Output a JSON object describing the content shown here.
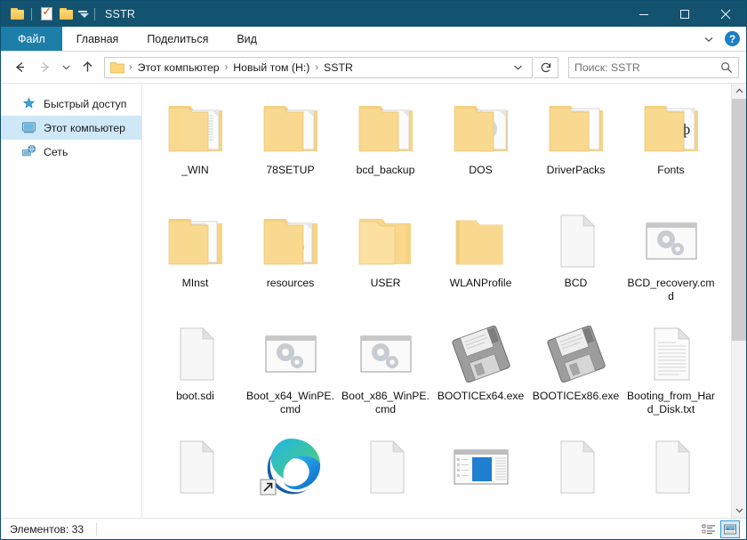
{
  "window": {
    "title": "SSTR",
    "quick_access": [
      "folder-icon",
      "properties-icon",
      "new-folder-icon",
      "customize-caret-icon"
    ],
    "controls": {
      "minimize": "Свернуть",
      "maximize": "Развернуть",
      "close": "Закрыть"
    },
    "titlebar_color": "#13536f",
    "accent_color": "#1d7eaa"
  },
  "ribbon": {
    "tabs": [
      {
        "label": "Файл",
        "active": true
      },
      {
        "label": "Главная",
        "active": false
      },
      {
        "label": "Поделиться",
        "active": false
      },
      {
        "label": "Вид",
        "active": false
      }
    ],
    "expand_icon": "chevron-down-icon",
    "help_label": "?"
  },
  "nav": {
    "back": "Назад",
    "forward": "Вперёд",
    "recent": "Последние папки",
    "up": "Вверх",
    "refresh_icon": "refresh-icon",
    "breadcrumb": [
      "Этот компьютер",
      "Новый том (H:)",
      "SSTR"
    ],
    "breadcrumb_sep": "›"
  },
  "search": {
    "placeholder": "Поиск: SSTR",
    "icon": "search-icon"
  },
  "sidebar": {
    "items": [
      {
        "label": "Быстрый доступ",
        "icon": "pin-star-icon",
        "selected": false
      },
      {
        "label": "Этот компьютер",
        "icon": "computer-icon",
        "selected": true
      },
      {
        "label": "Сеть",
        "icon": "network-icon",
        "selected": false
      }
    ]
  },
  "files": [
    {
      "name": "_WIN",
      "type": "folder",
      "preview": "text-doc"
    },
    {
      "name": "78SETUP",
      "type": "folder",
      "preview": "setup-exe"
    },
    {
      "name": "bcd_backup",
      "type": "folder",
      "preview": "blank-doc"
    },
    {
      "name": "DOS",
      "type": "folder",
      "preview": "disc"
    },
    {
      "name": "DriverPacks",
      "type": "folder",
      "preview": "lined-doc"
    },
    {
      "name": "Fonts",
      "type": "folder",
      "preview": "font-abf",
      "preview_text": "Абф"
    },
    {
      "name": "MInst",
      "type": "folder",
      "preview": "blank-doc"
    },
    {
      "name": "resources",
      "type": "folder",
      "preview": "gears-doc"
    },
    {
      "name": "USER",
      "type": "folder",
      "preview": "photo-doc"
    },
    {
      "name": "WLANProfile",
      "type": "folder",
      "preview": "empty"
    },
    {
      "name": "BCD",
      "type": "file",
      "preview": "blank-file"
    },
    {
      "name": "BCD_recovery.cmd",
      "type": "file",
      "preview": "cmd-gears"
    },
    {
      "name": "boot.sdi",
      "type": "file",
      "preview": "blank-file"
    },
    {
      "name": "Boot_x64_WinPE.cmd",
      "type": "file",
      "preview": "cmd-gears"
    },
    {
      "name": "Boot_x86_WinPE.cmd",
      "type": "file",
      "preview": "cmd-gears"
    },
    {
      "name": "BOOTICEx64.exe",
      "type": "file",
      "preview": "floppy"
    },
    {
      "name": "BOOTICEx86.exe",
      "type": "file",
      "preview": "floppy"
    },
    {
      "name": "Booting_from_Hard_Disk.txt",
      "type": "file",
      "preview": "text-lines"
    },
    {
      "name": "",
      "type": "file",
      "preview": "blank-file"
    },
    {
      "name": "",
      "type": "file",
      "preview": "edge-shortcut"
    },
    {
      "name": "",
      "type": "file",
      "preview": "blank-file"
    },
    {
      "name": "",
      "type": "file",
      "preview": "app-window"
    },
    {
      "name": "",
      "type": "file",
      "preview": "blank-file"
    },
    {
      "name": "",
      "type": "file",
      "preview": "blank-file"
    }
  ],
  "status": {
    "count_label": "Элементов: 33",
    "views": [
      {
        "icon": "details-view-icon",
        "active": false
      },
      {
        "icon": "large-icons-view-icon",
        "active": true
      }
    ]
  }
}
